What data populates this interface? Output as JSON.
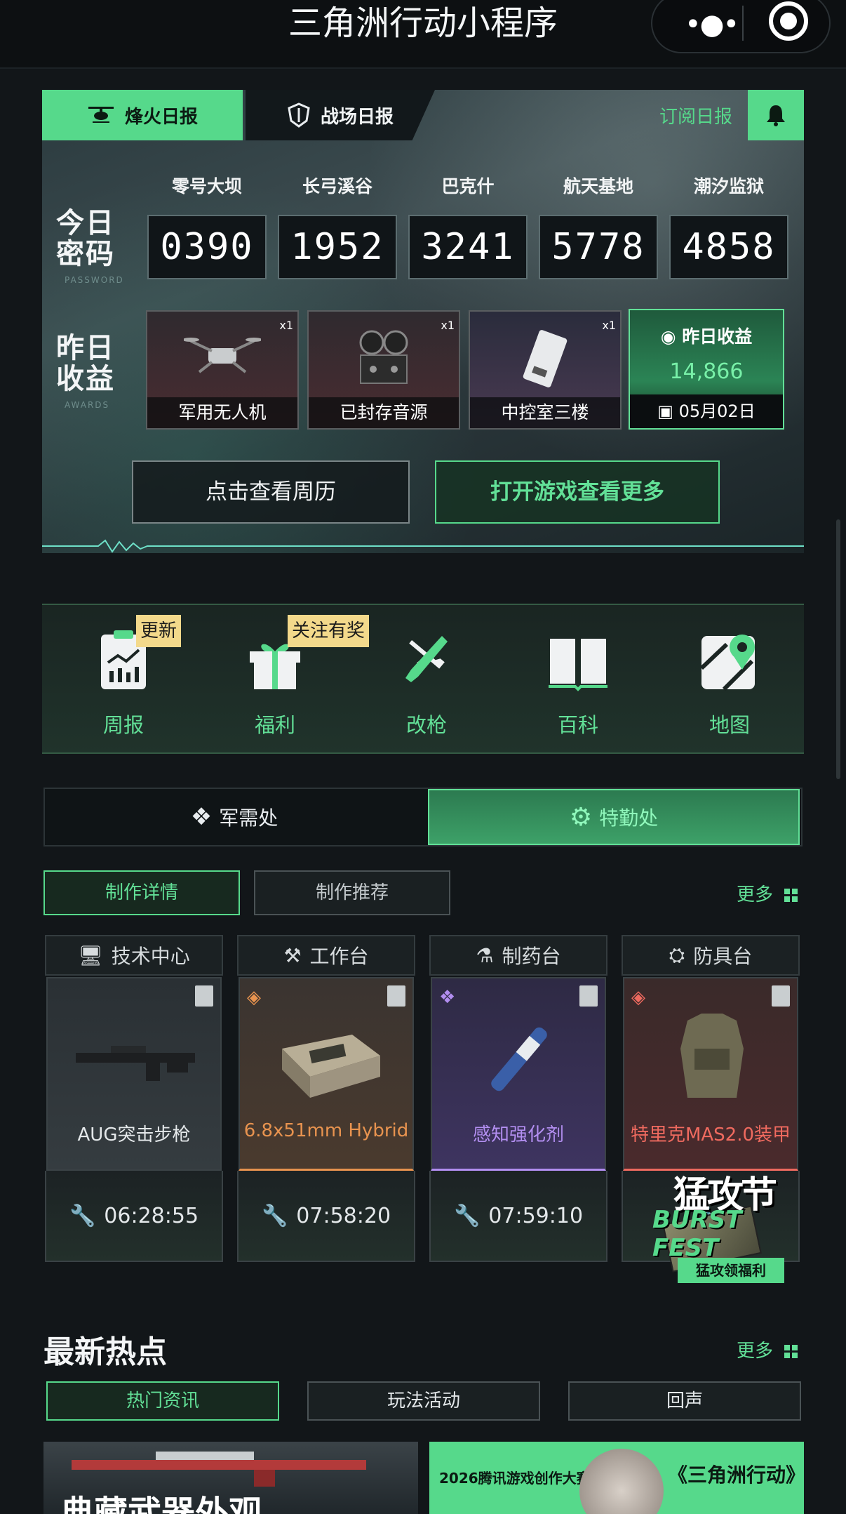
{
  "topbar": {
    "title": "三角洲行动小程序",
    "menu_icon": "more-dots-icon",
    "close_icon": "target-close-icon"
  },
  "hero": {
    "tabs": [
      {
        "label": "烽火日报",
        "icon": "helicopter-icon",
        "active": true
      },
      {
        "label": "战场日报",
        "icon": "shield-icon",
        "active": false
      }
    ],
    "subscribe": "订阅日报",
    "password_label_line1": "今日",
    "password_label_line2": "密码",
    "password_sub": "PASSWORD",
    "maps": [
      {
        "name": "零号大坝",
        "code": "0390"
      },
      {
        "name": "长弓溪谷",
        "code": "1952"
      },
      {
        "name": "巴克什",
        "code": "3241"
      },
      {
        "name": "航天基地",
        "code": "5778"
      },
      {
        "name": "潮汐监狱",
        "code": "4858"
      }
    ],
    "awards_label_line1": "昨日",
    "awards_label_line2": "收益",
    "awards_sub": "AWARDS",
    "rewards": [
      {
        "name": "军用无人机",
        "count": "x1"
      },
      {
        "name": "已封存音源",
        "count": "x1"
      },
      {
        "name": "中控室三楼",
        "count": "x1"
      }
    ],
    "income": {
      "label": "昨日收益",
      "value": "14,866",
      "date": "05月02日"
    },
    "btn_week": "点击查看周历",
    "btn_game": "打开游戏查看更多"
  },
  "quick": [
    {
      "label": "周报",
      "badge": "更新",
      "icon": "weekly-report-icon"
    },
    {
      "label": "福利",
      "badge": "关注有奖",
      "icon": "gift-icon"
    },
    {
      "label": "改枪",
      "badge": "",
      "icon": "gun-wrench-icon"
    },
    {
      "label": "百科",
      "badge": "",
      "icon": "book-icon"
    },
    {
      "label": "地图",
      "badge": "",
      "icon": "map-pin-icon"
    }
  ],
  "segments": {
    "left": "军需处",
    "right": "特勤处"
  },
  "craft": {
    "tab_detail": "制作详情",
    "tab_recommend": "制作推荐",
    "more": "更多",
    "benches": [
      {
        "station": "技术中心",
        "icon": "monitor-icon",
        "item": "AUG突击步枪",
        "time": "06:28:55",
        "color": "#e4e8ea"
      },
      {
        "station": "工作台",
        "icon": "tools-icon",
        "item": "6.8x51mm Hybrid",
        "time": "07:58:20",
        "color": "#e8934f"
      },
      {
        "station": "制药台",
        "icon": "microscope-icon",
        "item": "感知强化剂",
        "time": "07:59:10",
        "color": "#b28ef0"
      },
      {
        "station": "防具台",
        "icon": "armor-icon",
        "item": "特里克MAS2.0装甲",
        "time": "",
        "color": "#ef6a5f"
      }
    ]
  },
  "promo": {
    "title": "猛攻节",
    "subtitle": "BURST FEST",
    "button": "猛攻领福利"
  },
  "news": {
    "title": "最新热点",
    "more": "更多",
    "tabs": [
      "热门资讯",
      "玩法活动",
      "回声"
    ],
    "card_a_text": "典藏武器外观",
    "card_b_tag": "2026腾讯游戏创作大赛",
    "card_b_title": "《三角洲行动》"
  },
  "colors": {
    "accent": "#56d98b",
    "accent_text": "#62e097",
    "bg": "#121619"
  }
}
